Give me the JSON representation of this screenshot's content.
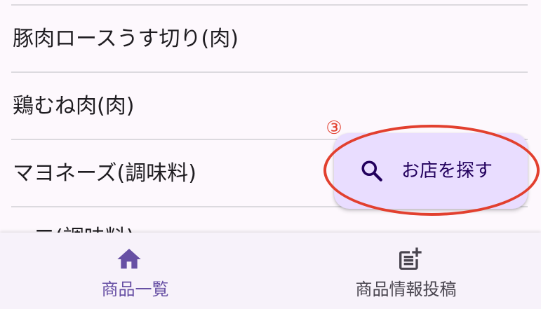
{
  "product_list": {
    "items": [
      {
        "name": "豚肉ロースうす切り(肉)"
      },
      {
        "name": "鶏むね肉(肉)"
      },
      {
        "name": "マヨネーズ(調味料)"
      },
      {
        "name": "一二(調味料)"
      }
    ]
  },
  "fab": {
    "label": "お店を探す",
    "icon": "search-icon",
    "color": "#e9ddff"
  },
  "annotation": {
    "number": "③",
    "color": "#e2402f"
  },
  "bottom_nav": {
    "items": [
      {
        "label": "商品一覧",
        "icon": "home-icon",
        "selected": true,
        "color": "#6750a4"
      },
      {
        "label": "商品情報投稿",
        "icon": "post-add-icon",
        "selected": false,
        "color": "#49454f"
      }
    ]
  }
}
